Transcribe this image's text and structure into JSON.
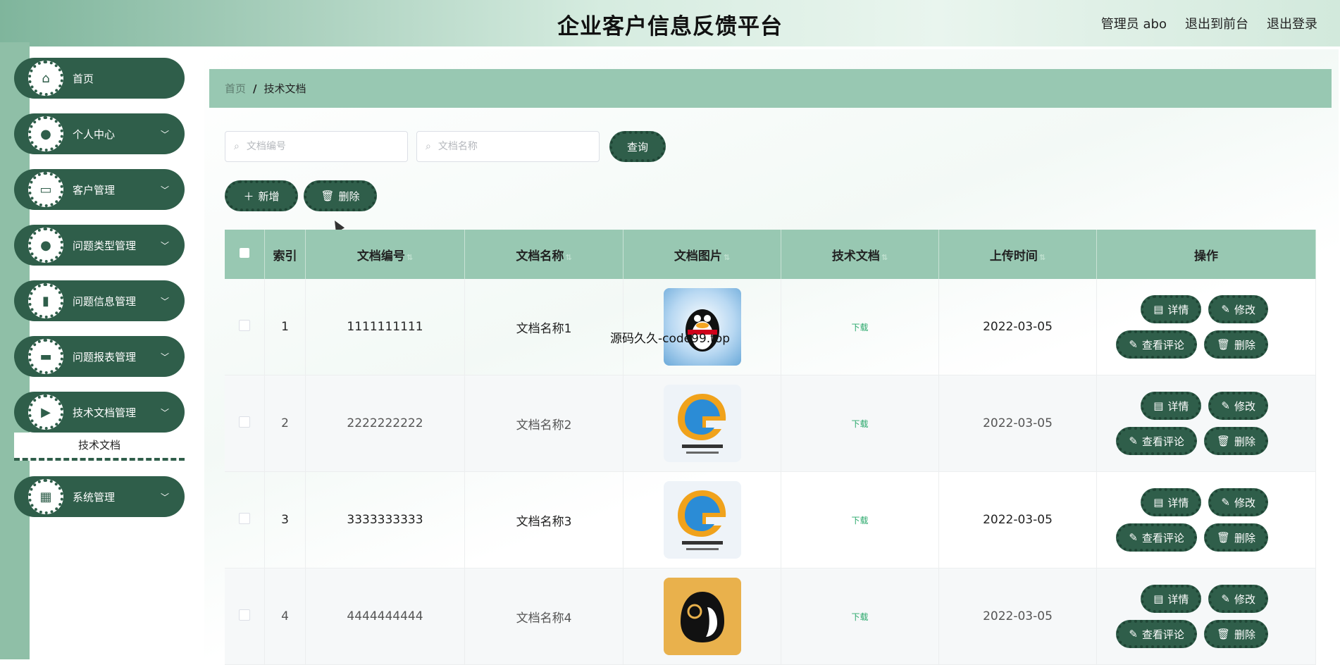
{
  "header": {
    "title": "企业客户信息反馈平台",
    "user": "管理员 abo",
    "front_link": "退出到前台",
    "logout_link": "退出登录"
  },
  "sidebar": {
    "items": [
      {
        "label": "首页",
        "icon": "home-icon"
      },
      {
        "label": "个人中心",
        "icon": "user-icon"
      },
      {
        "label": "客户管理",
        "icon": "monitor-icon"
      },
      {
        "label": "问题类型管理",
        "icon": "user-icon"
      },
      {
        "label": "问题信息管理",
        "icon": "book-icon"
      },
      {
        "label": "问题报表管理",
        "icon": "chat-icon"
      },
      {
        "label": "技术文档管理",
        "icon": "video-icon"
      },
      {
        "label": "系统管理",
        "icon": "grid-icon"
      }
    ],
    "submenu_active": "技术文档"
  },
  "breadcrumb": {
    "home": "首页",
    "separator": "/",
    "current": "技术文档"
  },
  "search": {
    "doc_no_placeholder": "文档编号",
    "doc_name_placeholder": "文档名称",
    "query_label": "查询"
  },
  "actions": {
    "add_label": "新增",
    "delete_label": "删除"
  },
  "table": {
    "headers": {
      "index": "索引",
      "doc_no": "文档编号",
      "doc_name": "文档名称",
      "doc_image": "文档图片",
      "tech_doc": "技术文档",
      "upload_time": "上传时间",
      "operation": "操作"
    },
    "ops": {
      "detail": "详情",
      "edit": "修改",
      "comments": "查看评论",
      "delete": "删除"
    },
    "download_label": "下载",
    "rows": [
      {
        "index": "1",
        "doc_no": "1111111111",
        "doc_name": "文档名称1",
        "image": "qq-penguin",
        "upload_time": "2022-03-05"
      },
      {
        "index": "2",
        "doc_no": "2222222222",
        "doc_name": "文档名称2",
        "image": "tencent-games",
        "upload_time": "2022-03-05"
      },
      {
        "index": "3",
        "doc_no": "3333333333",
        "doc_name": "文档名称3",
        "image": "tencent-games",
        "upload_time": "2022-03-05"
      },
      {
        "index": "4",
        "doc_no": "4444444444",
        "doc_name": "文档名称4",
        "image": "penguin-app",
        "upload_time": "2022-03-05"
      }
    ]
  },
  "overlay_text": "源码久久-code99.top",
  "colors": {
    "primary": "#2f5e4a",
    "accent": "#98c8b2",
    "download": "#2aa86b"
  }
}
